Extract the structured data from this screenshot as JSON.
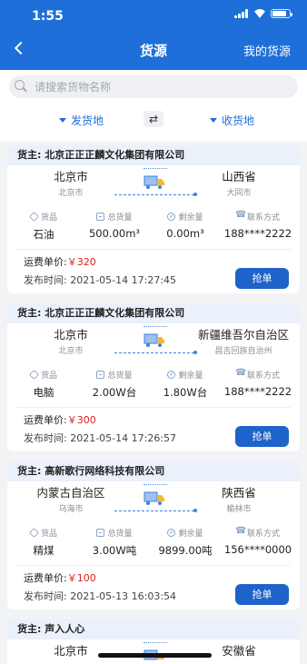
{
  "status_bar": {
    "time": "1:55"
  },
  "header": {
    "title": "货源",
    "right_action": "我的货源"
  },
  "search": {
    "placeholder": "请搜索货物名称"
  },
  "filters": {
    "origin": "发货地",
    "destination": "收货地"
  },
  "labels": {
    "goods": "货品",
    "total": "总货量",
    "remaining": "剩余量",
    "contact": "联系方式",
    "price": "运费单价:",
    "publish": "发布时间:",
    "grab": "抢单",
    "currency": "￥"
  },
  "cards": [
    {
      "owner": "货主: 北京正正正麟文化集团有限公司",
      "from_prov": "北京市",
      "from_city": "北京市",
      "to_prov": "山西省",
      "to_city": "大同市",
      "goods": "石油",
      "total": "500.00m³",
      "remaining": "0.00m³",
      "phone": "188****2222",
      "price": "320",
      "time": "2021-05-14 17:27:45"
    },
    {
      "owner": "货主: 北京正正正麟文化集团有限公司",
      "from_prov": "北京市",
      "from_city": "北京市",
      "to_prov": "新疆维吾尔自治区",
      "to_city": "昌吉回族自治州",
      "goods": "电脑",
      "total": "2.00W台",
      "remaining": "1.80W台",
      "phone": "188****2222",
      "price": "300",
      "time": "2021-05-14 17:26:57"
    },
    {
      "owner": "货主: 高新歌行网络科技有限公司",
      "from_prov": "内蒙古自治区",
      "from_city": "乌海市",
      "to_prov": "陕西省",
      "to_city": "榆林市",
      "goods": "精煤",
      "total": "3.00W吨",
      "remaining": "9899.00吨",
      "phone": "156****0000",
      "price": "100",
      "time": "2021-05-13 16:03:54"
    },
    {
      "owner": "货主: 声入人心",
      "from_prov": "北京市",
      "to_prov": "安徽省"
    }
  ]
}
